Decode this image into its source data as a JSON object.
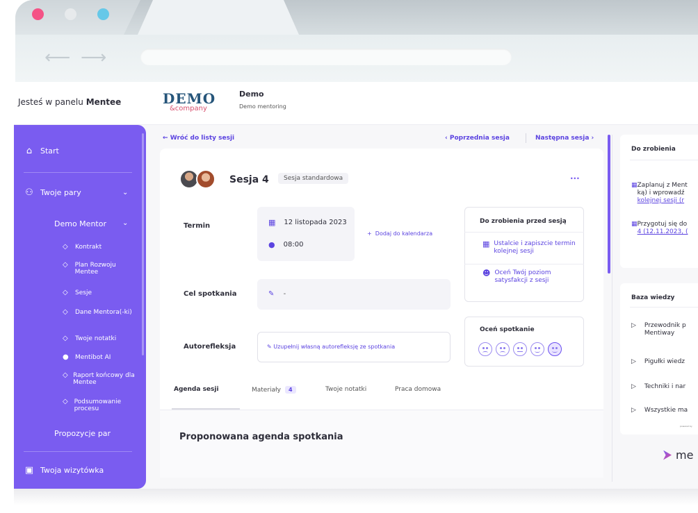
{
  "topbar": {
    "panel_prefix": "Jesteś w panelu",
    "panel_role": "Mentee",
    "logo_main": "DEMO",
    "logo_sub": "&company",
    "company_name": "Demo",
    "company_sub": "Demo mentoring"
  },
  "sidebar": {
    "start": "Start",
    "pairs": "Twoje pary",
    "mentor": "Demo Mentor",
    "sub_items": [
      "Kontrakt",
      "Plan Rozwoju Mentee",
      "Sesje",
      "Dane Mentora(-ki)",
      "Twoje notatki",
      "Mentibot AI",
      "Raport końcowy dla Mentee",
      "Podsumowanie procesu"
    ],
    "proposals": "Propozycje par",
    "card": "Twoja wizytówka"
  },
  "nav": {
    "back": "Wróć do listy sesji",
    "prev": "Poprzednia sesja",
    "next": "Następna sesja"
  },
  "session": {
    "title": "Sesja 4",
    "type": "Sesja standardowa",
    "term_label": "Termin",
    "date": "12 listopada 2023",
    "time": "08:00",
    "add_calendar": "Dodaj do kalendarza",
    "goal_label": "Cel spotkania",
    "goal_value": "-",
    "reflection_label": "Autorefleksja",
    "reflection_cta": "Uzupełnij własną autorefleksję ze spotkania"
  },
  "before": {
    "title": "Do zrobienia przed sesją",
    "items": [
      "Ustalcie i zapiszcie termin kolejnej sesji",
      "Oceń Twój poziom satysfakcji z sesji"
    ]
  },
  "rating": {
    "title": "Oceń spotkanie",
    "selected_index": 4
  },
  "tabs": {
    "agenda": "Agenda sesji",
    "materials": "Materiały",
    "materials_count": "4",
    "notes": "Twoje notatki",
    "homework": "Praca domowa"
  },
  "agenda": {
    "title": "Proponowana agenda spotkania"
  },
  "right_panel": {
    "todo_title": "Do zrobienia",
    "todo_1_line1": "Zaplanuj z Ment",
    "todo_1_line2": "ką) i wprowadź",
    "todo_1_link": "kolejnej sesji (r",
    "todo_2_line1": "Przygotuj się do",
    "todo_2_link": "4 (12.11.2023, (",
    "kb_title": "Baza wiedzy",
    "kb_items": [
      "Przewodnik p",
      "Mentiway",
      "Pigułki wiedz",
      "Techniki i nar",
      "Wszystkie ma"
    ],
    "powered": "powered by",
    "brand": "me"
  },
  "colors": {
    "accent": "#7a5cf0",
    "link": "#5b43e0"
  }
}
